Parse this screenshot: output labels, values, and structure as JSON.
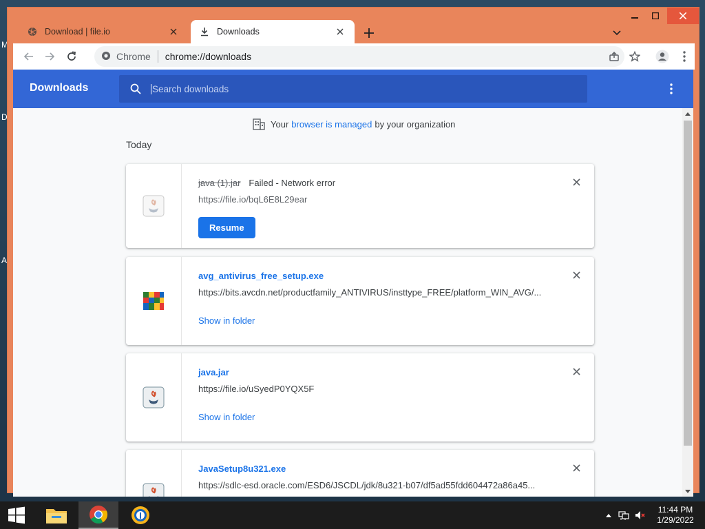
{
  "desktop": {
    "letters": [
      "M",
      "D",
      "A"
    ]
  },
  "browser": {
    "tabs": [
      {
        "title": "Download | file.io",
        "icon": "globe-icon",
        "active": false
      },
      {
        "title": "Downloads",
        "icon": "download-icon",
        "active": true
      }
    ],
    "omnibox": {
      "scheme_label": "Chrome",
      "url": "chrome://downloads"
    }
  },
  "downloads_page": {
    "title": "Downloads",
    "search_placeholder": "Search downloads",
    "managed": {
      "prefix": "Your",
      "link": "browser is managed",
      "suffix": "by your organization"
    },
    "section": "Today",
    "items": [
      {
        "name": "java (1).jar",
        "status": "Failed - Network error",
        "url": "https://file.io/bqL6E8L29ear",
        "action": "Resume",
        "icon": "java-file-icon"
      },
      {
        "name": "avg_antivirus_free_setup.exe",
        "url": "https://bits.avcdn.net/productfamily_ANTIVIRUS/insttype_FREE/platform_WIN_AVG/...",
        "action": "Show in folder",
        "icon": "avg-logo-icon"
      },
      {
        "name": "java.jar",
        "url": "https://file.io/uSyedP0YQX5F",
        "action": "Show in folder",
        "icon": "java-file-icon"
      },
      {
        "name": "JavaSetup8u321.exe",
        "url": "https://sdlc-esd.oracle.com/ESD6/JSCDL/jdk/8u321-b07/df5ad55fdd604472a86a45...",
        "icon": "java-file-icon"
      }
    ]
  },
  "taskbar": {
    "time": "11:44 PM",
    "date": "1/29/2022"
  },
  "colors": {
    "frame": "#e9855b",
    "header": "#3367d6",
    "link": "#1a73e8"
  }
}
